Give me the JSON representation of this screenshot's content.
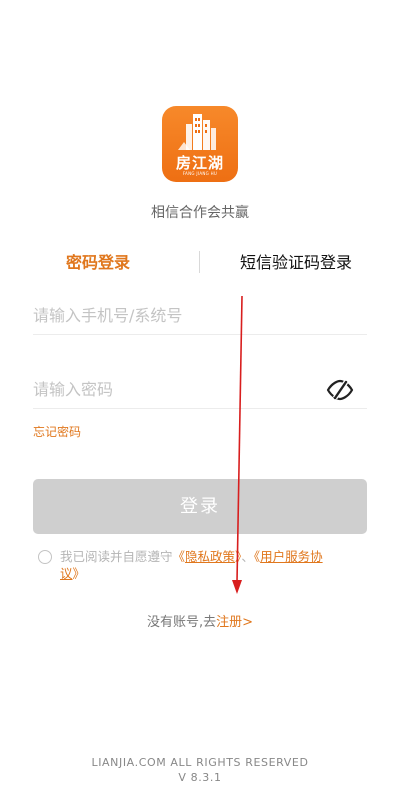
{
  "app": {
    "logo_text": "房江湖",
    "logo_subtext": "FANG JIANG HU",
    "slogan": "相信合作会共赢",
    "brand_color": "#ee6f13"
  },
  "tabs": {
    "password_login": "密码登录",
    "sms_login": "短信验证码登录",
    "active": "password_login"
  },
  "form": {
    "phone_placeholder": "请输入手机号/系统号",
    "password_placeholder": "请输入密码",
    "forgot_password": "忘记密码",
    "login_button": "登录",
    "password_visibility_icon": "eye-off-icon"
  },
  "agreement": {
    "prefix": "我已阅读并自愿遵守",
    "privacy_open": "《",
    "privacy_policy": "隐私政策",
    "privacy_close": "》",
    "separator": "、",
    "service_open": "《",
    "service_agreement_part1": "用户服务协",
    "service_agreement_part2": "议",
    "service_close": "》",
    "checked": false
  },
  "register": {
    "prompt": "没有账号,去",
    "link": "注册>"
  },
  "footer": {
    "copyright": "LIANJIA.COM  ALL  RIGHTS  RESERVED",
    "version": "V  8.3.1"
  },
  "colors": {
    "accent": "#e0771d",
    "disabled_button": "#cfcfcf",
    "annotation_arrow": "#d81e1e"
  }
}
